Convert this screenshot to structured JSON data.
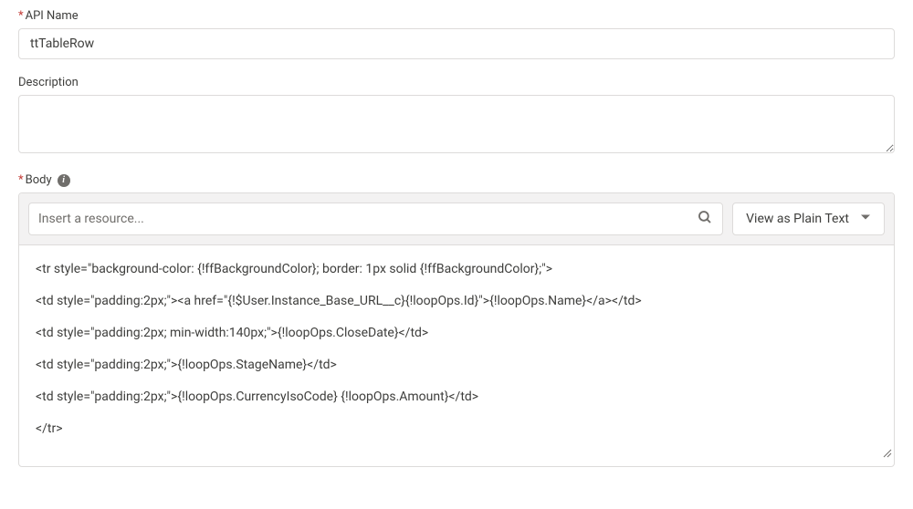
{
  "apiName": {
    "label": "API Name",
    "value": "ttTableRow",
    "required": true
  },
  "description": {
    "label": "Description",
    "value": "",
    "required": false
  },
  "body": {
    "label": "Body",
    "required": true,
    "resourcePlaceholder": "Insert a resource...",
    "viewButtonLabel": "View as Plain Text",
    "lines": [
      "<tr style=\"background-color: {!ffBackgroundColor}; border: 1px solid {!ffBackgroundColor};\">",
      "<td style=\"padding:2px;\"><a href=\"{!$User.Instance_Base_URL__c}{!loopOps.Id}\">{!loopOps.Name}</a></td>",
      "<td style=\"padding:2px; min-width:140px;\">{!loopOps.CloseDate}</td>",
      "<td style=\"padding:2px;\">{!loopOps.StageName}</td>",
      "<td style=\"padding:2px;\">{!loopOps.CurrencyIsoCode} {!loopOps.Amount}</td>",
      "</tr>"
    ]
  }
}
